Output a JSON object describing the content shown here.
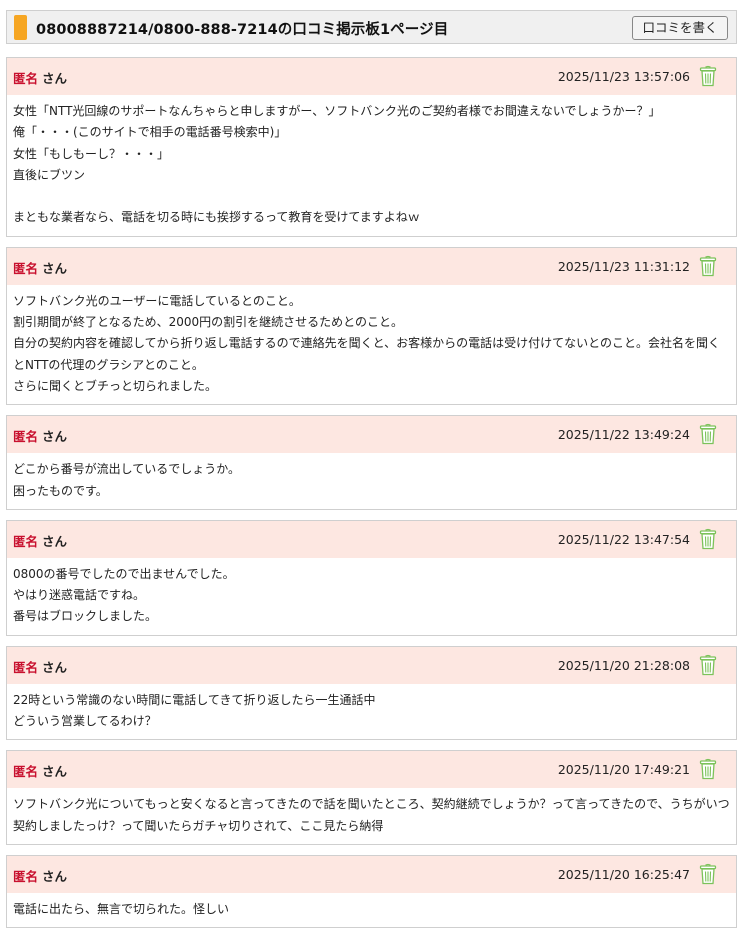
{
  "header": {
    "title": "08008887214/0800-888-7214の口コミ掲示板1ページ目",
    "write_button": "口コミを書く"
  },
  "posts": [
    {
      "name": "匿名",
      "honorific": "さん",
      "date": "2025/11/23 13:57:06",
      "lines": [
        "女性「NTT光回線のサポートなんちゃらと申しますがー、ソフトバンク光のご契約者様でお間違えないでしょうかー？」",
        "俺「・・・(このサイトで相手の電話番号検索中)」",
        "女性「もしもーし？・・・」",
        "直後にブツン",
        "",
        "まともな業者なら、電話を切る時にも挨拶するって教育を受けてますよねｗ"
      ]
    },
    {
      "name": "匿名",
      "honorific": "さん",
      "date": "2025/11/23 11:31:12",
      "lines": [
        "ソフトバンク光のユーザーに電話しているとのこと。",
        "割引期間が終了となるため、2000円の割引を継続させるためとのこと。",
        "自分の契約内容を確認してから折り返し電話するので連絡先を聞くと、お客様からの電話は受け付けてないとのこと。会社名を聞く",
        "とNTTの代理のグラシアとのこと。",
        "さらに聞くとブチっと切られました。"
      ]
    },
    {
      "name": "匿名",
      "honorific": "さん",
      "date": "2025/11/22 13:49:24",
      "lines": [
        "どこから番号が流出しているでしょうか。",
        "困ったものです。"
      ]
    },
    {
      "name": "匿名",
      "honorific": "さん",
      "date": "2025/11/22 13:47:54",
      "lines": [
        "0800の番号でしたので出ませんでした。",
        "やはり迷惑電話ですね。",
        "番号はブロックしました。"
      ]
    },
    {
      "name": "匿名",
      "honorific": "さん",
      "date": "2025/11/20 21:28:08",
      "lines": [
        "22時という常識のない時間に電話してきて折り返したら一生通話中",
        "どういう営業してるわけ？"
      ]
    },
    {
      "name": "匿名",
      "honorific": "さん",
      "date": "2025/11/20 17:49:21",
      "lines": [
        "ソフトバンク光についてもっと安くなると言ってきたので話を聞いたところ、契約継続でしょうか？って言ってきたので、うちがいつ",
        "契約しましたっけ？って聞いたらガチャ切りされて、ここ見たら納得"
      ]
    },
    {
      "name": "匿名",
      "honorific": "さん",
      "date": "2025/11/20 16:25:47",
      "lines": [
        "電話に出たら、無言で切られた。怪しい"
      ]
    }
  ],
  "icons": {
    "delete": "trash-icon"
  },
  "colors": {
    "accent": "#f6a623",
    "post_header_bg": "#fde7e1",
    "name_red": "#c8102e",
    "trash_green": "#7cc25a"
  }
}
